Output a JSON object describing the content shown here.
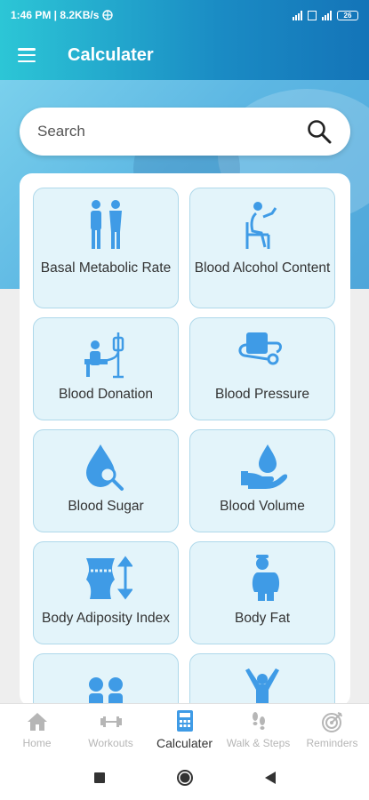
{
  "status_bar": {
    "time_speed": "1:46 PM | 8.2KB/s",
    "battery": "26"
  },
  "app_bar": {
    "title": "Calculater",
    "menu_icon": "hamburger-menu-icon"
  },
  "search": {
    "placeholder": "Search",
    "icon": "search-icon"
  },
  "accent_color": "#3f9be6",
  "calculators": [
    {
      "label": "Basal Metabolic Rate",
      "icon": "couple-icon"
    },
    {
      "label": "Blood Alcohol Content",
      "icon": "person-drinking-icon"
    },
    {
      "label": "Blood Donation",
      "icon": "blood-donation-icon"
    },
    {
      "label": "Blood Pressure",
      "icon": "blood-pressure-icon"
    },
    {
      "label": "Blood Sugar",
      "icon": "blood-drop-magnifier-icon"
    },
    {
      "label": "Blood Volume",
      "icon": "drop-hand-icon"
    },
    {
      "label": "Body Adiposity Index",
      "icon": "waist-measure-icon"
    },
    {
      "label": "Body Fat",
      "icon": "body-fat-icon"
    },
    {
      "label": "",
      "icon": "couple-icon"
    },
    {
      "label": "",
      "icon": "person-arms-up-icon"
    }
  ],
  "bottom_nav": [
    {
      "label": "Home",
      "icon": "home-icon",
      "active": false
    },
    {
      "label": "Workouts",
      "icon": "dumbbell-icon",
      "active": false
    },
    {
      "label": "Calculater",
      "icon": "calculator-icon",
      "active": true
    },
    {
      "label": "Walk & Steps",
      "icon": "footsteps-icon",
      "active": false
    },
    {
      "label": "Reminders",
      "icon": "target-icon",
      "active": false
    }
  ]
}
